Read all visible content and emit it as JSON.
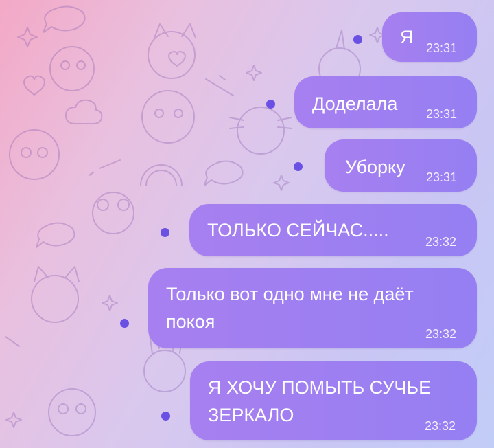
{
  "chat": {
    "messages": [
      {
        "text": "Я",
        "time": "23:31"
      },
      {
        "text": "Доделала",
        "time": "23:31"
      },
      {
        "text": "Уборку",
        "time": "23:31"
      },
      {
        "text": "ТОЛЬКО СЕЙЧАС.....",
        "time": "23:32"
      },
      {
        "text": "Только вот одно мне не даёт\nпокоя",
        "time": "23:32"
      },
      {
        "text": "Я ХОЧУ ПОМЫТЬ СУЧЬЕ\nЗЕРКАЛО",
        "time": "23:32"
      }
    ]
  },
  "theme": {
    "bubble_color": "#9a7ff1",
    "unread_dot_color": "#6b51e3"
  }
}
